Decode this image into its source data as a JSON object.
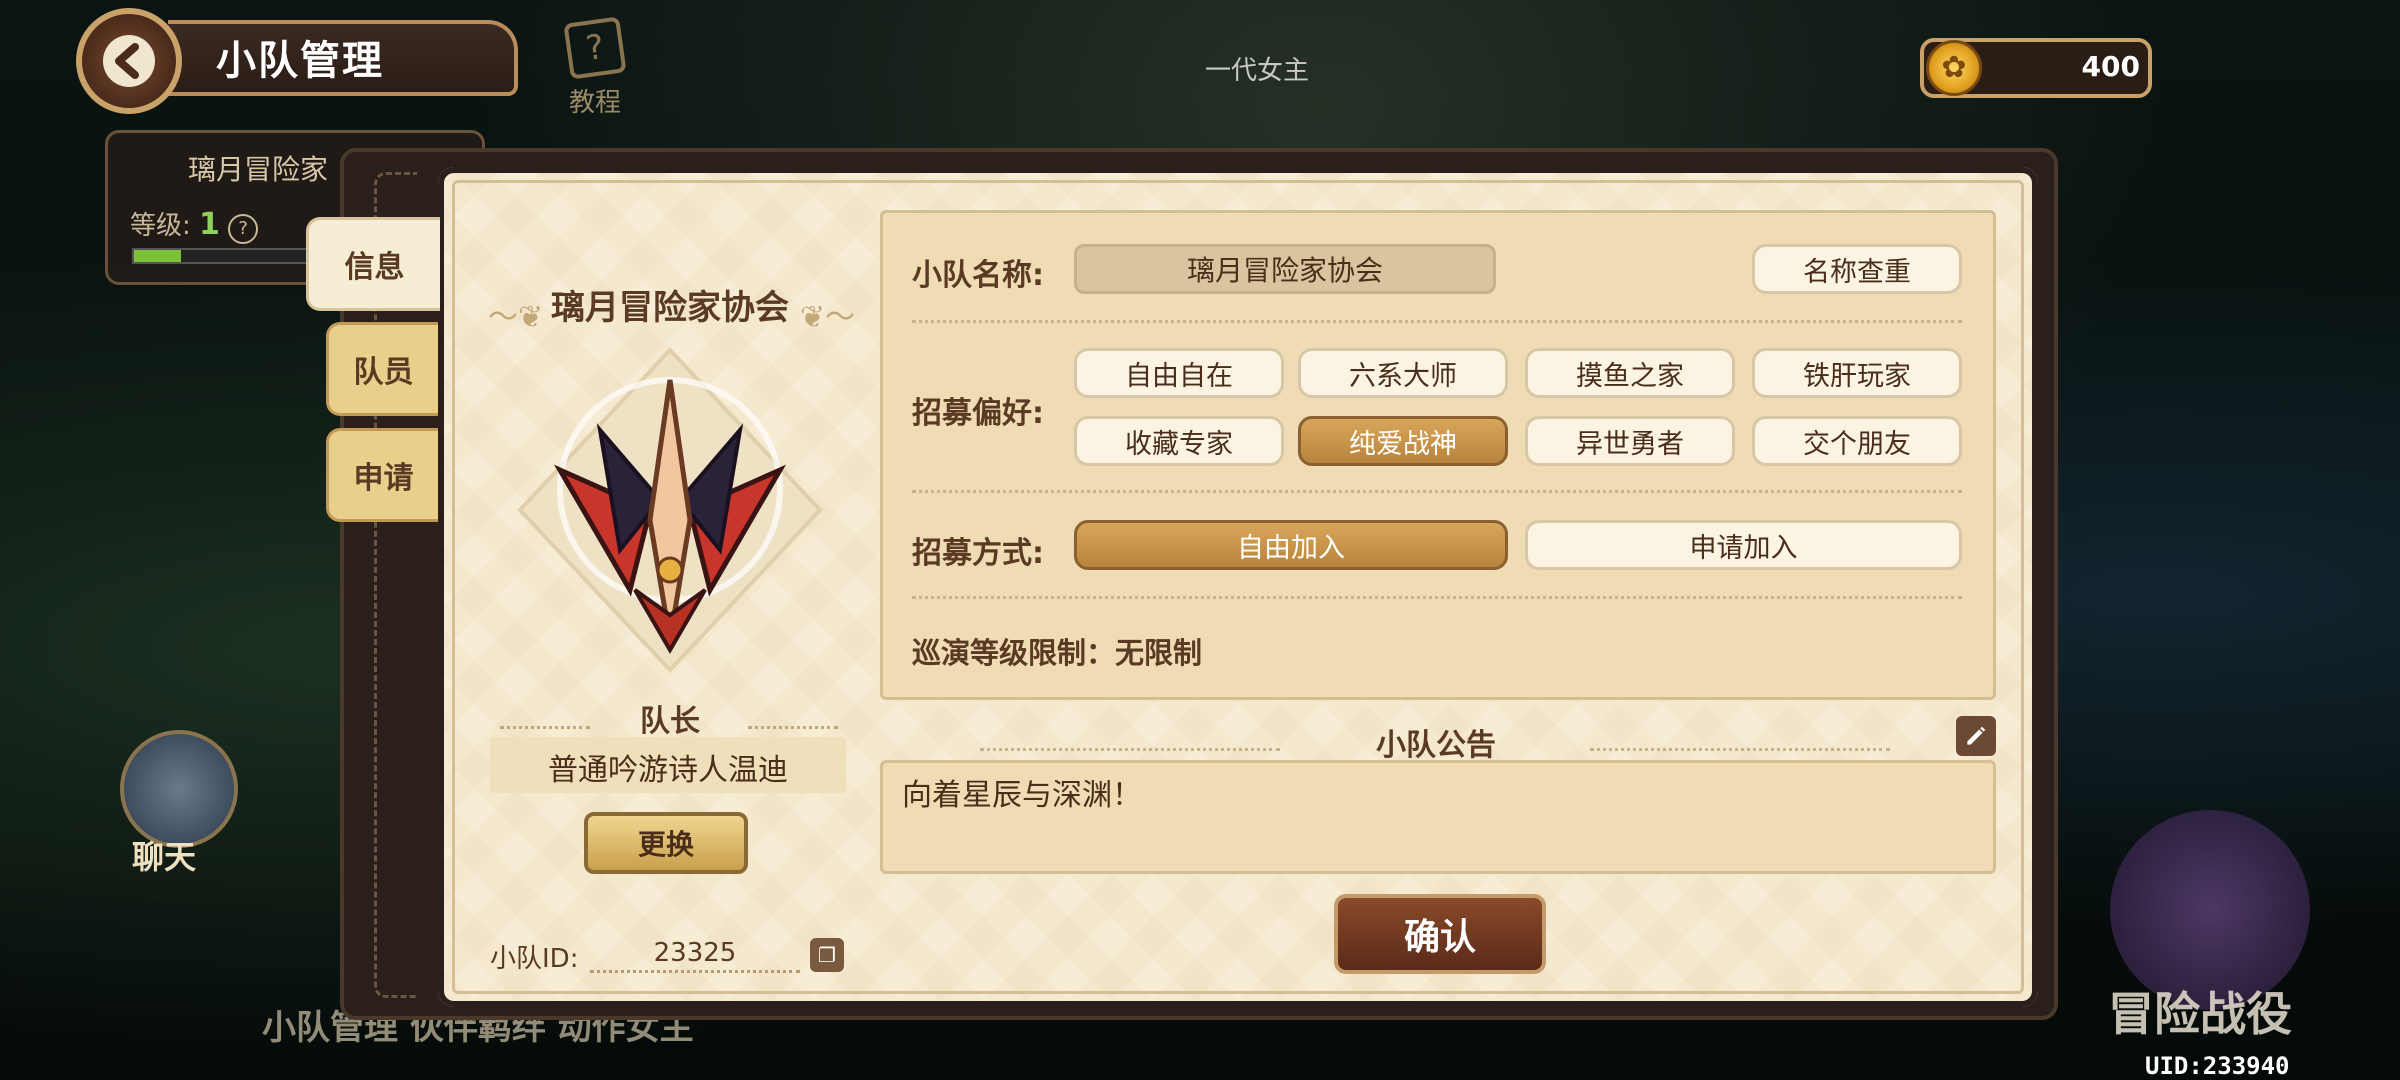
{
  "header": {
    "title": "小队管理",
    "tutorial_label": "教程",
    "npc_label": "一代女主",
    "coins": "400"
  },
  "background": {
    "team_card_name": "璃月冒险家",
    "team_level_label": "等级:",
    "team_level_value": "1",
    "chat_label": "聊天",
    "nav_strip": "小队管理  伙伴羁绊  动作女主",
    "battle_label": "冒险战役",
    "uid": "UID:233940"
  },
  "tabs": [
    {
      "label": "信息",
      "active": true
    },
    {
      "label": "队员",
      "active": false
    },
    {
      "label": "申请",
      "active": false
    }
  ],
  "team": {
    "name": "璃月冒险家协会",
    "leader_label": "队长",
    "leader_name": "普通吟游诗人温迪",
    "change_label": "更换",
    "id_label": "小队ID:",
    "id_value": "23325"
  },
  "info": {
    "name_label": "小队名称:",
    "name_value": "璃月冒险家协会",
    "name_check_label": "名称查重",
    "pref_label": "招募偏好:",
    "prefs": [
      {
        "label": "自由自在",
        "selected": false
      },
      {
        "label": "六系大师",
        "selected": false
      },
      {
        "label": "摸鱼之家",
        "selected": false
      },
      {
        "label": "铁肝玩家",
        "selected": false
      },
      {
        "label": "收藏专家",
        "selected": false
      },
      {
        "label": "纯爱战神",
        "selected": true
      },
      {
        "label": "异世勇者",
        "selected": false
      },
      {
        "label": "交个朋友",
        "selected": false
      }
    ],
    "method_label": "招募方式:",
    "methods": [
      {
        "label": "自由加入",
        "selected": true
      },
      {
        "label": "申请加入",
        "selected": false
      }
    ],
    "limit_text": "巡演等级限制：无限制"
  },
  "notice": {
    "title": "小队公告",
    "text": "向着星辰与深渊！"
  },
  "confirm_label": "确认",
  "colors": {
    "accent_gold": "#c9a04c",
    "selected_chip": "#c8944a",
    "confirm_brown": "#6a3a22",
    "panel_cream": "#f7ecd4"
  }
}
